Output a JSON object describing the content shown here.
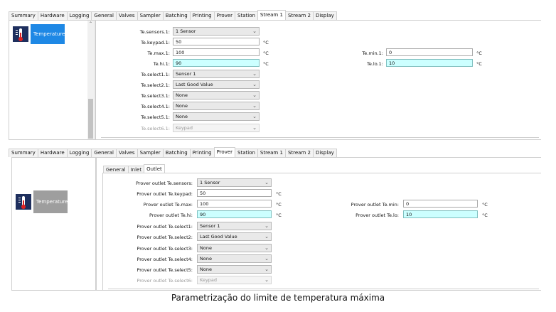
{
  "colors": {
    "selected_item_bg": "#1e88e5",
    "disabled_item_bg": "#9e9e9e",
    "highlight_input": "#ccffff",
    "panel_border": "#cfcfcf"
  },
  "top": {
    "tabs": [
      "Summary",
      "Hardware",
      "Logging",
      "General",
      "Valves",
      "Sampler",
      "Batching",
      "Printing",
      "Prover",
      "Station",
      "Stream 1",
      "Stream 2",
      "Display"
    ],
    "active_tab": "Stream 1",
    "side_item": {
      "label": "Temperature",
      "icon": "thermometer-icon"
    },
    "fields": {
      "sensors_label": "Te.sensors.1:",
      "sensors_value": "1 Sensor",
      "keypad_label": "Te.keypad.1:",
      "keypad_value": "50",
      "keypad_unit": "°C",
      "max_label": "Te.max.1:",
      "max_value": "100",
      "max_unit": "°C",
      "hi_label": "Te.hi.1:",
      "hi_value": "90",
      "hi_unit": "°C",
      "min_label": "Te.min.1:",
      "min_value": "0",
      "min_unit": "°C",
      "lo_label": "Te.lo.1:",
      "lo_value": "10",
      "lo_unit": "°C",
      "select1_label": "Te.select1.1:",
      "select1_value": "Sensor 1",
      "select2_label": "Te.select2.1:",
      "select2_value": "Last Good Value",
      "select3_label": "Te.select3.1:",
      "select3_value": "None",
      "select4_label": "Te.select4.1:",
      "select4_value": "None",
      "select5_label": "Te.select5.1:",
      "select5_value": "None",
      "select6_label": "Te.select6.1:",
      "select6_value": "Keypad"
    }
  },
  "bottom": {
    "tabs": [
      "Summary",
      "Hardware",
      "Logging",
      "General",
      "Valves",
      "Sampler",
      "Batching",
      "Printing",
      "Prover",
      "Station",
      "Stream 1",
      "Stream 2",
      "Display"
    ],
    "active_tab": "Prover",
    "subtabs": [
      "General",
      "Inlet",
      "Outlet"
    ],
    "active_subtab": "Outlet",
    "side_item": {
      "label": "Temperature",
      "icon": "thermometer-icon"
    },
    "fields": {
      "sensors_label": "Prover outlet Te.sensors:",
      "sensors_value": "1 Sensor",
      "keypad_label": "Prover outlet Te.keypad:",
      "keypad_value": "50",
      "keypad_unit": "°C",
      "max_label": "Prover outlet Te.max:",
      "max_value": "100",
      "max_unit": "°C",
      "hi_label": "Prover outlet Te.hi:",
      "hi_value": "90",
      "hi_unit": "°C",
      "min_label": "Prover outlet Te.min:",
      "min_value": "0",
      "min_unit": "°C",
      "lo_label": "Prover outlet Te.lo:",
      "lo_value": "10",
      "lo_unit": "°C",
      "select1_label": "Prover outlet Te.select1:",
      "select1_value": "Sensor 1",
      "select2_label": "Prover outlet Te.select2:",
      "select2_value": "Last Good Value",
      "select3_label": "Prover outlet Te.select3:",
      "select3_value": "None",
      "select4_label": "Prover outlet Te.select4:",
      "select4_value": "None",
      "select5_label": "Prover outlet Te.select5:",
      "select5_value": "None",
      "select6_label": "Prover outlet Te.select6:",
      "select6_value": "Keypad"
    }
  },
  "caption": "Parametrização do limite de temperatura máxima"
}
